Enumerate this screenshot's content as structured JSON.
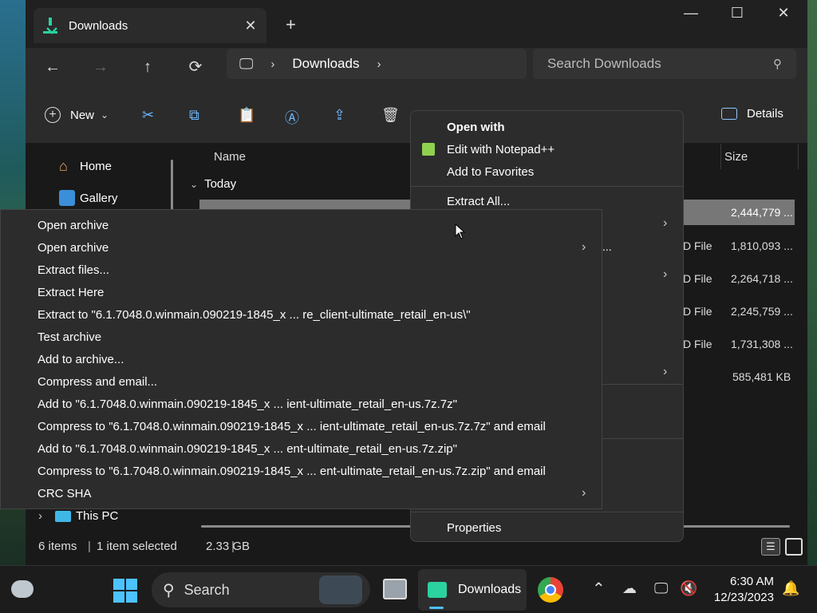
{
  "window": {
    "tab_title": "Downloads",
    "address_segments": [
      "Downloads"
    ],
    "search_placeholder": "Search Downloads"
  },
  "commandbar": {
    "new_label": "New",
    "details_label": "Details"
  },
  "sidebar": {
    "items": [
      {
        "label": "Home",
        "icon": "home-icon"
      },
      {
        "label": "Gallery",
        "icon": "gallery-icon"
      },
      {
        "label": "This PC",
        "icon": "monitor-icon"
      }
    ]
  },
  "filelist": {
    "col_name": "Name",
    "col_size": "Size",
    "group": "Today",
    "rows": [
      {
        "type": "",
        "size": "2,444,779 ..."
      },
      {
        "type": "D File",
        "size": "1,810,093 ..."
      },
      {
        "type": "D File",
        "size": "2,264,718 ..."
      },
      {
        "type": "D File",
        "size": "2,245,759 ..."
      },
      {
        "type": "D File",
        "size": "1,731,308 ..."
      },
      {
        "type": "",
        "size": "585,481 KB"
      }
    ],
    "partial_text": "..."
  },
  "status": {
    "items_count": "6 items",
    "selection": "1 item selected",
    "selection_size": "2.33 GB"
  },
  "context_menu": {
    "open_with": "Open with",
    "edit_notepad": "Edit with Notepad++",
    "add_favorites": "Add to Favorites",
    "extract_all": "Extract All...",
    "properties": "Properties"
  },
  "submenu_7zip": {
    "items": [
      "Open archive",
      "Open archive",
      "Extract files...",
      "Extract Here",
      "Extract to \"6.1.7048.0.winmain.090219-1845_x ... re_client-ultimate_retail_en-us\\\"",
      "Test archive",
      "Add to archive...",
      "Compress and email...",
      "Add to \"6.1.7048.0.winmain.090219-1845_x ... ient-ultimate_retail_en-us.7z.7z\"",
      "Compress to \"6.1.7048.0.winmain.090219-1845_x ... ient-ultimate_retail_en-us.7z.7z\" and email",
      "Add to \"6.1.7048.0.winmain.090219-1845_x ... ent-ultimate_retail_en-us.7z.zip\"",
      "Compress to \"6.1.7048.0.winmain.090219-1845_x ... ent-ultimate_retail_en-us.7z.zip\" and email",
      "CRC SHA"
    ]
  },
  "taskbar": {
    "search_label": "Search",
    "active_app": "Downloads",
    "time": "6:30 AM",
    "date": "12/23/2023"
  },
  "colors": {
    "accent": "#4cc2ff",
    "download_green": "#2bd19f",
    "menu_bg": "#2c2c2c",
    "window_bg": "#191919"
  }
}
